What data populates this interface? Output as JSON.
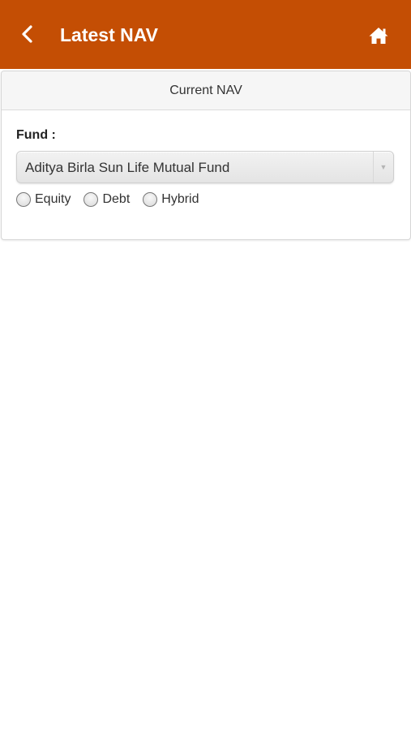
{
  "header": {
    "title": "Latest NAV",
    "back_icon": "chevron-left-icon",
    "home_icon": "home-icon",
    "background_color": "#c44e04"
  },
  "card": {
    "title": "Current NAV",
    "fund_label": "Fund :",
    "fund_select": {
      "selected": "Aditya Birla Sun Life Mutual Fund",
      "arrow_icon": "caret-down-icon"
    },
    "radio_options": [
      {
        "label": "Equity",
        "checked": false
      },
      {
        "label": "Debt",
        "checked": false
      },
      {
        "label": "Hybrid",
        "checked": false
      }
    ]
  }
}
